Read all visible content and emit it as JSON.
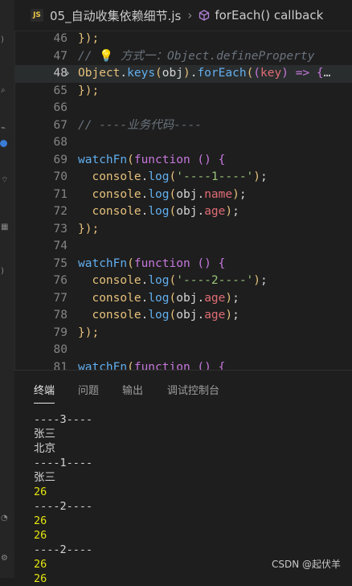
{
  "breadcrumb": {
    "file": "05_自动收集依赖细节.js",
    "symbol": "forEach() callback"
  },
  "editor": {
    "lines": [
      {
        "n": "46",
        "tokens": [
          {
            "t": "});",
            "c": "brk"
          }
        ]
      },
      {
        "n": "47",
        "tokens": [
          {
            "t": "// ",
            "c": "cm"
          },
          {
            "t": "💡",
            "c": "var"
          },
          {
            "t": " 方式一：Object.defineProperty",
            "c": "cm"
          }
        ]
      },
      {
        "n": "48",
        "active": true,
        "fold": true,
        "tokens": [
          {
            "t": "Object",
            "c": "var"
          },
          {
            "t": ".",
            "c": "plain"
          },
          {
            "t": "keys",
            "c": "fn"
          },
          {
            "t": "(",
            "c": "brk"
          },
          {
            "t": "obj",
            "c": "plain"
          },
          {
            "t": ")",
            "c": "brk"
          },
          {
            "t": ".",
            "c": "plain"
          },
          {
            "t": "forEach",
            "c": "fn"
          },
          {
            "t": "(",
            "c": "brk"
          },
          {
            "t": "(",
            "c": "brk2"
          },
          {
            "t": "key",
            "c": "prop"
          },
          {
            "t": ")",
            "c": "brk2"
          },
          {
            "t": " => ",
            "c": "kw"
          },
          {
            "t": "{",
            "c": "brk2"
          },
          {
            "t": "…",
            "c": "plain"
          }
        ]
      },
      {
        "n": "65",
        "tokens": [
          {
            "t": "});",
            "c": "brk"
          }
        ]
      },
      {
        "n": "66",
        "tokens": []
      },
      {
        "n": "67",
        "tokens": [
          {
            "t": "// ----业务代码----",
            "c": "cm"
          }
        ]
      },
      {
        "n": "68",
        "tokens": []
      },
      {
        "n": "69",
        "tokens": [
          {
            "t": "watchFn",
            "c": "fn"
          },
          {
            "t": "(",
            "c": "brk"
          },
          {
            "t": "function",
            "c": "kw"
          },
          {
            "t": " ",
            "c": "plain"
          },
          {
            "t": "()",
            "c": "brk2"
          },
          {
            "t": " ",
            "c": "plain"
          },
          {
            "t": "{",
            "c": "brk2"
          }
        ]
      },
      {
        "n": "70",
        "tokens": [
          {
            "t": "  console",
            "c": "var"
          },
          {
            "t": ".",
            "c": "plain"
          },
          {
            "t": "log",
            "c": "fn"
          },
          {
            "t": "(",
            "c": "brk"
          },
          {
            "t": "'----1----'",
            "c": "str"
          },
          {
            "t": ")",
            "c": "brk"
          },
          {
            "t": ";",
            "c": "plain"
          }
        ]
      },
      {
        "n": "71",
        "tokens": [
          {
            "t": "  console",
            "c": "var"
          },
          {
            "t": ".",
            "c": "plain"
          },
          {
            "t": "log",
            "c": "fn"
          },
          {
            "t": "(",
            "c": "brk"
          },
          {
            "t": "obj",
            "c": "plain"
          },
          {
            "t": ".",
            "c": "plain"
          },
          {
            "t": "name",
            "c": "prop"
          },
          {
            "t": ")",
            "c": "brk"
          },
          {
            "t": ";",
            "c": "plain"
          }
        ]
      },
      {
        "n": "72",
        "tokens": [
          {
            "t": "  console",
            "c": "var"
          },
          {
            "t": ".",
            "c": "plain"
          },
          {
            "t": "log",
            "c": "fn"
          },
          {
            "t": "(",
            "c": "brk"
          },
          {
            "t": "obj",
            "c": "plain"
          },
          {
            "t": ".",
            "c": "plain"
          },
          {
            "t": "age",
            "c": "prop"
          },
          {
            "t": ")",
            "c": "brk"
          },
          {
            "t": ";",
            "c": "plain"
          }
        ]
      },
      {
        "n": "73",
        "tokens": [
          {
            "t": "});",
            "c": "brk"
          }
        ]
      },
      {
        "n": "74",
        "tokens": []
      },
      {
        "n": "75",
        "tokens": [
          {
            "t": "watchFn",
            "c": "fn"
          },
          {
            "t": "(",
            "c": "brk"
          },
          {
            "t": "function",
            "c": "kw"
          },
          {
            "t": " ",
            "c": "plain"
          },
          {
            "t": "()",
            "c": "brk2"
          },
          {
            "t": " ",
            "c": "plain"
          },
          {
            "t": "{",
            "c": "brk2"
          }
        ]
      },
      {
        "n": "76",
        "tokens": [
          {
            "t": "  console",
            "c": "var"
          },
          {
            "t": ".",
            "c": "plain"
          },
          {
            "t": "log",
            "c": "fn"
          },
          {
            "t": "(",
            "c": "brk"
          },
          {
            "t": "'----2----'",
            "c": "str"
          },
          {
            "t": ")",
            "c": "brk"
          },
          {
            "t": ";",
            "c": "plain"
          }
        ]
      },
      {
        "n": "77",
        "tokens": [
          {
            "t": "  console",
            "c": "var"
          },
          {
            "t": ".",
            "c": "plain"
          },
          {
            "t": "log",
            "c": "fn"
          },
          {
            "t": "(",
            "c": "brk"
          },
          {
            "t": "obj",
            "c": "plain"
          },
          {
            "t": ".",
            "c": "plain"
          },
          {
            "t": "age",
            "c": "prop"
          },
          {
            "t": ")",
            "c": "brk"
          },
          {
            "t": ";",
            "c": "plain"
          }
        ]
      },
      {
        "n": "78",
        "tokens": [
          {
            "t": "  console",
            "c": "var"
          },
          {
            "t": ".",
            "c": "plain"
          },
          {
            "t": "log",
            "c": "fn"
          },
          {
            "t": "(",
            "c": "brk"
          },
          {
            "t": "obj",
            "c": "plain"
          },
          {
            "t": ".",
            "c": "plain"
          },
          {
            "t": "age",
            "c": "prop"
          },
          {
            "t": ")",
            "c": "brk"
          },
          {
            "t": ";",
            "c": "plain"
          }
        ]
      },
      {
        "n": "79",
        "tokens": [
          {
            "t": "});",
            "c": "brk"
          }
        ]
      },
      {
        "n": "80",
        "tokens": []
      },
      {
        "n": "81",
        "tokens": [
          {
            "t": "watchFn",
            "c": "fn"
          },
          {
            "t": "(",
            "c": "brk"
          },
          {
            "t": "function",
            "c": "kw"
          },
          {
            "t": " () {",
            "c": "brk2"
          }
        ]
      }
    ]
  },
  "panel": {
    "tabs": [
      "终端",
      "问题",
      "输出",
      "调试控制台"
    ],
    "active_tab": "终端",
    "output": [
      {
        "t": "----3----"
      },
      {
        "t": "张三"
      },
      {
        "t": "北京"
      },
      {
        "t": "----1----"
      },
      {
        "t": "张三"
      },
      {
        "t": "26",
        "num": true
      },
      {
        "t": "----2----"
      },
      {
        "t": "26",
        "num": true
      },
      {
        "t": "26",
        "num": true
      },
      {
        "t": "----2----"
      },
      {
        "t": "26",
        "num": true
      },
      {
        "t": "26",
        "num": true
      }
    ]
  },
  "watermark": "CSDN @起伏羊",
  "colors": {
    "keyword": "#c678dd",
    "function": "#61afef",
    "string": "#98c379",
    "property": "#e06c75",
    "variable": "#e5c07b",
    "comment": "#6a737d",
    "terminal_number": "#e5e510"
  }
}
